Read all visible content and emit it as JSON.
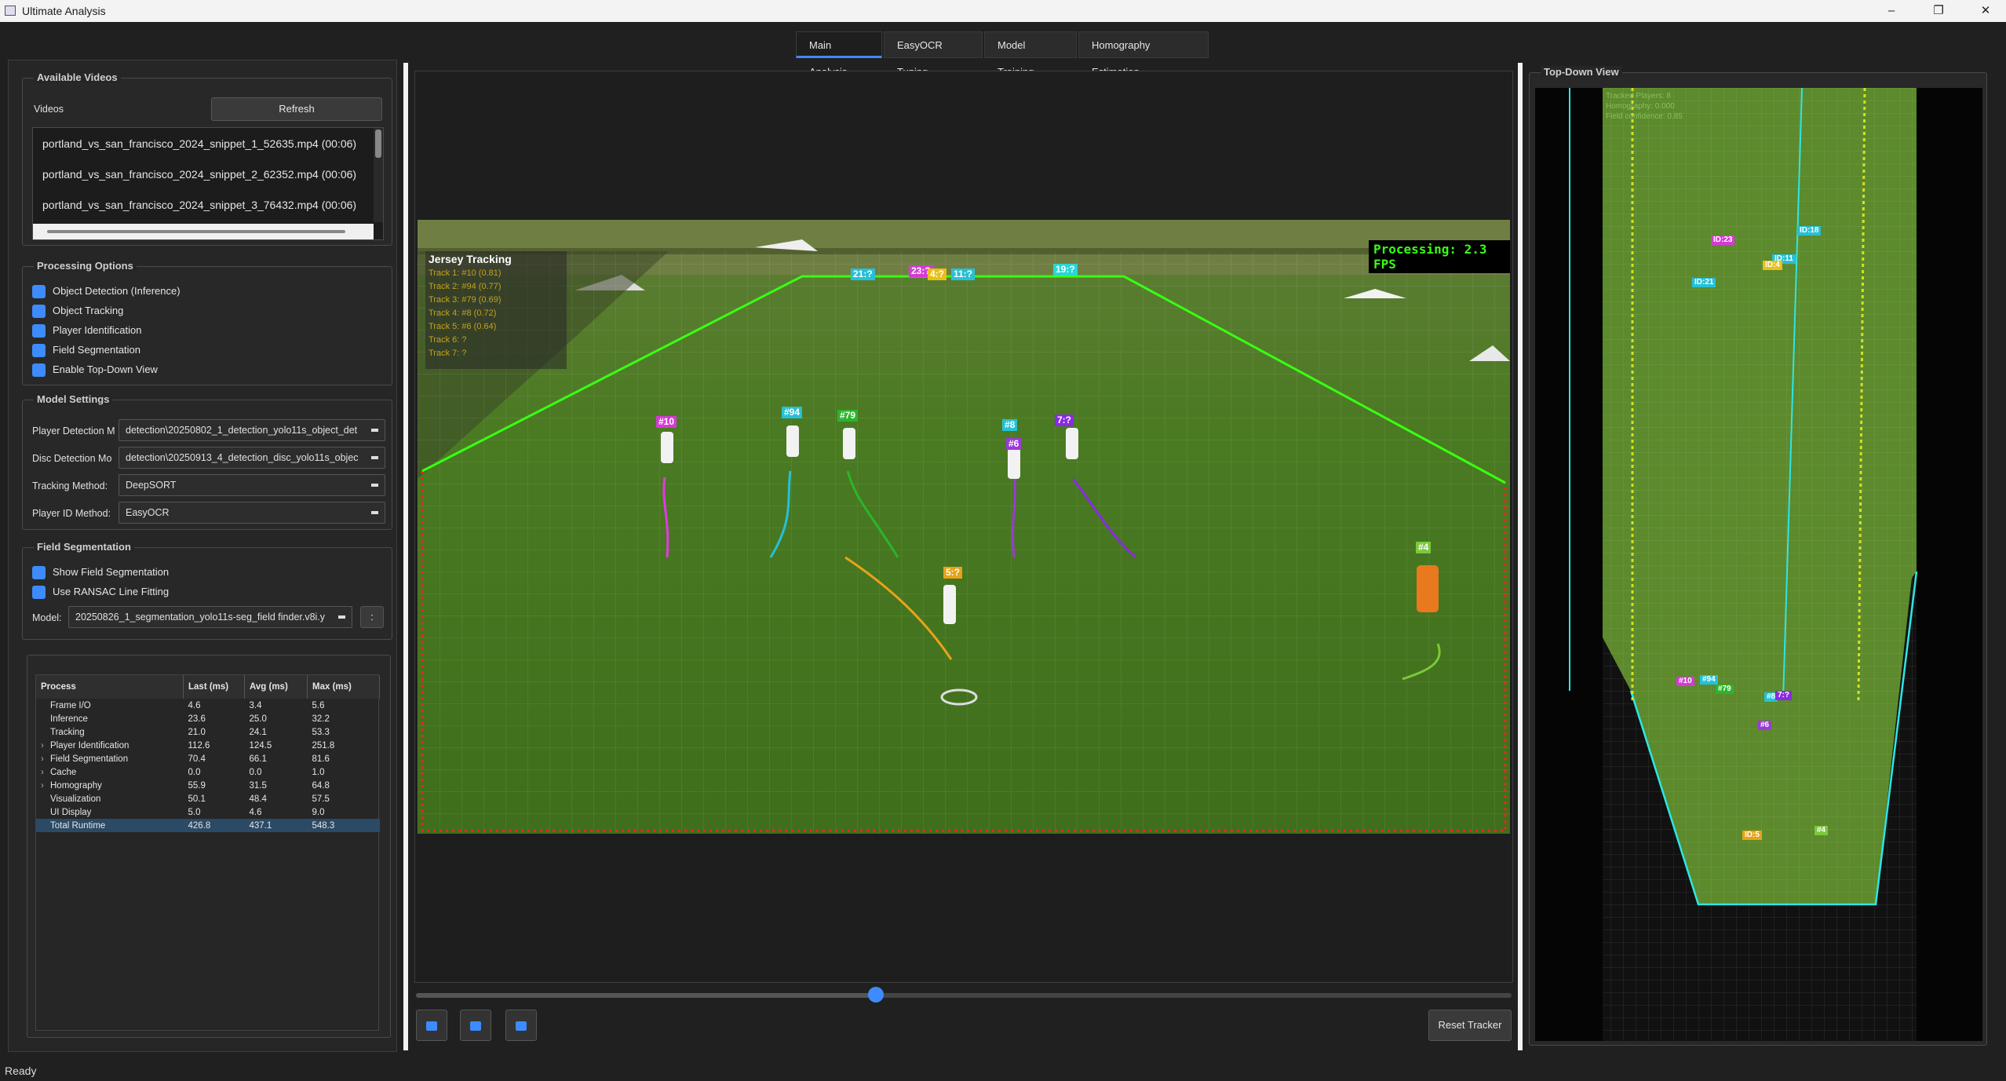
{
  "window": {
    "title": "Ultimate Analysis",
    "minimize": "–",
    "restore": "❐",
    "close": "✕"
  },
  "tabs": [
    {
      "label": "Main Analysis",
      "active": true
    },
    {
      "label": "EasyOCR Tuning"
    },
    {
      "label": "Model Training"
    },
    {
      "label": "Homography Estimation"
    }
  ],
  "videos_group": {
    "title": "Available Videos",
    "videos_label": "Videos",
    "refresh_label": "Refresh",
    "items": [
      "portland_vs_san_francisco_2024_snippet_1_52635.mp4 (00:06)",
      "portland_vs_san_francisco_2024_snippet_2_62352.mp4 (00:06)",
      "portland_vs_san_francisco_2024_snippet_3_76432.mp4 (00:06)"
    ]
  },
  "processing_options": {
    "title": "Processing Options",
    "options": [
      {
        "label": "Object Detection (Inference)",
        "checked": true
      },
      {
        "label": "Object Tracking",
        "checked": true
      },
      {
        "label": "Player Identification",
        "checked": true
      },
      {
        "label": "Field Segmentation",
        "checked": true
      },
      {
        "label": "Enable Top-Down View",
        "checked": true
      }
    ]
  },
  "model_settings": {
    "title": "Model Settings",
    "rows": [
      {
        "label": "Player Detection M",
        "value": "detection\\20250802_1_detection_yolo11s_object_det"
      },
      {
        "label": "Disc Detection Mo",
        "value": "detection\\20250913_4_detection_disc_yolo11s_objec"
      },
      {
        "label": "Tracking Method:",
        "value": "DeepSORT"
      },
      {
        "label": "Player ID Method:",
        "value": "EasyOCR"
      }
    ]
  },
  "field_segmentation": {
    "title": "Field Segmentation",
    "show_label": "Show Field Segmentation",
    "ransac_label": "Use RANSAC Line Fitting",
    "model_label": "Model:",
    "model_value": "20250826_1_segmentation_yolo11s-seg_field finder.v8i.y",
    "browse_label": ":"
  },
  "performance": {
    "columns": [
      "Process",
      "Last (ms)",
      "Avg (ms)",
      "Max (ms)"
    ],
    "rows": [
      {
        "name": "Frame I/O",
        "expand": false,
        "last": "4.6",
        "avg": "3.4",
        "max": "5.6"
      },
      {
        "name": "Inference",
        "expand": false,
        "last": "23.6",
        "avg": "25.0",
        "max": "32.2"
      },
      {
        "name": "Tracking",
        "expand": false,
        "last": "21.0",
        "avg": "24.1",
        "max": "53.3"
      },
      {
        "name": "Player Identification",
        "expand": true,
        "last": "112.6",
        "avg": "124.5",
        "max": "251.8"
      },
      {
        "name": "Field Segmentation",
        "expand": true,
        "last": "70.4",
        "avg": "66.1",
        "max": "81.6"
      },
      {
        "name": "Cache",
        "expand": true,
        "last": "0.0",
        "avg": "0.0",
        "max": "1.0"
      },
      {
        "name": "Homography",
        "expand": true,
        "last": "55.9",
        "avg": "31.5",
        "max": "64.8"
      },
      {
        "name": "Visualization",
        "expand": false,
        "last": "50.1",
        "avg": "48.4",
        "max": "57.5"
      },
      {
        "name": "UI Display",
        "expand": false,
        "last": "5.0",
        "avg": "4.6",
        "max": "9.0"
      },
      {
        "name": "Total Runtime",
        "expand": false,
        "last": "426.8",
        "avg": "437.1",
        "max": "548.3",
        "selected": true
      }
    ]
  },
  "video": {
    "fps_overlay": "Processing: 2.3 FPS",
    "jersey_panel_title": "Jersey Tracking",
    "jersey_panel_lines": [
      "Track 1: #10 (0.81)",
      "Track 2: #94 (0.77)",
      "Track 3: #79 (0.69)",
      "Track 4: #8 (0.72)",
      "Track 5: #6 (0.64)",
      "Track 6: ?",
      "Track 7: ?"
    ],
    "track_labels": [
      {
        "text": "#10",
        "color": "#d63ad6"
      },
      {
        "text": "#94",
        "color": "#27c0d6"
      },
      {
        "text": "#79",
        "color": "#2bb52b"
      },
      {
        "text": "#8",
        "color": "#27c0d6"
      },
      {
        "text": "7:?",
        "color": "#8a2be2"
      },
      {
        "text": "#6",
        "color": "#9b3ad6"
      },
      {
        "text": "5:?",
        "color": "#e8a317"
      },
      {
        "text": "#4",
        "color": "#7ac93a"
      },
      {
        "text": "21:?",
        "color": "#27c0d6"
      },
      {
        "text": "23:?",
        "color": "#d63ad6"
      },
      {
        "text": "4:?",
        "color": "#e8c017"
      },
      {
        "text": "11:?",
        "color": "#27c0d6"
      },
      {
        "text": "19:?",
        "color": "#27d6d6"
      }
    ],
    "playback_progress": 0.42
  },
  "controls": {
    "rewind_icon": "rewind-icon",
    "pause_icon": "pause-icon",
    "forward_icon": "fast-forward-icon",
    "reset_label": "Reset Tracker"
  },
  "topdown": {
    "title": "Top-Down View",
    "overlay_lines": [
      "Tracked Players: 8",
      "Homography: 0.000",
      "Field confidence: 0.85"
    ],
    "markers": [
      {
        "text": "ID:23",
        "color": "#d63ad6"
      },
      {
        "text": "ID:18",
        "color": "#27c0d6"
      },
      {
        "text": "ID:11",
        "color": "#27c0d6"
      },
      {
        "text": "ID:4",
        "color": "#e8c017"
      },
      {
        "text": "ID:21",
        "color": "#27c0d6"
      },
      {
        "text": "#10",
        "color": "#d63ad6"
      },
      {
        "text": "#94",
        "color": "#27c0d6"
      },
      {
        "text": "#79",
        "color": "#2bb52b"
      },
      {
        "text": "#8",
        "color": "#27c0d6"
      },
      {
        "text": "7:?",
        "color": "#8a2be2"
      },
      {
        "text": "#6",
        "color": "#9b3ad6"
      },
      {
        "text": "ID:5",
        "color": "#e8a317"
      },
      {
        "text": "#4",
        "color": "#7ac93a"
      }
    ]
  },
  "status_bar": {
    "text": "Ready"
  },
  "colors": {
    "accent": "#3d8bfd",
    "field_green": "#4e7a2c",
    "line_green": "#39ff14",
    "line_cyan": "#2ee6e6",
    "boundary_red": "#ff2020"
  }
}
